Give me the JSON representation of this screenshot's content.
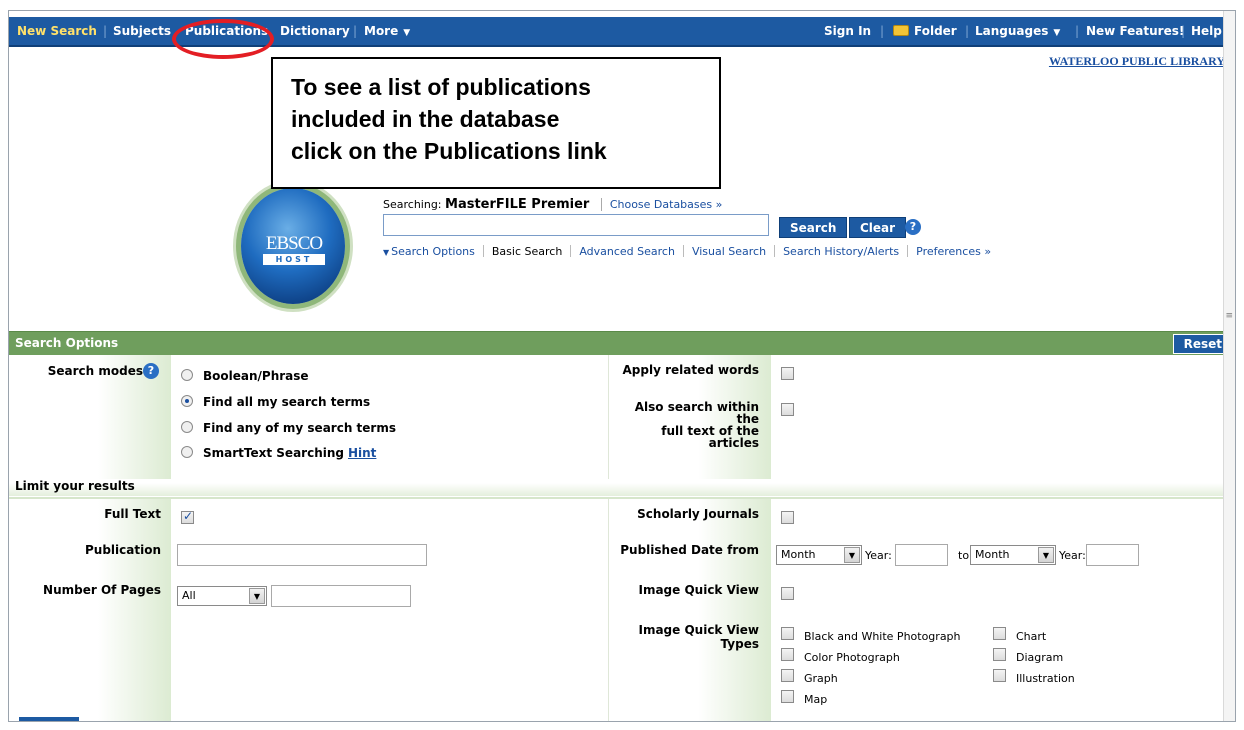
{
  "topnav": {
    "new_search": "New Search",
    "subjects": "Subjects",
    "publications": "Publications",
    "dictionary": "Dictionary",
    "more": "More",
    "sign_in": "Sign In",
    "folder": "Folder",
    "languages": "Languages",
    "new_features": "New Features!",
    "help": "Help"
  },
  "library_name": "WATERLOO PUBLIC LIBRARY",
  "callout": {
    "line1": "To see a list of publications",
    "line2": "included in the database",
    "line3": "click on the Publications link"
  },
  "logo": {
    "text": "EBSCO",
    "subtext": "HOST"
  },
  "search": {
    "searching_label": "Searching:",
    "database": "MasterFILE Premier",
    "choose_databases": "Choose Databases »",
    "query": "",
    "search_button": "Search",
    "clear_button": "Clear",
    "help": "?"
  },
  "subnav": {
    "search_options": "Search Options",
    "basic_search": "Basic Search",
    "advanced_search": "Advanced Search",
    "visual_search": "Visual Search",
    "search_history": "Search History/Alerts",
    "preferences": "Preferences »"
  },
  "search_options": {
    "title": "Search Options",
    "reset": "Reset",
    "search_modes_label": "Search modes",
    "modes": [
      "Boolean/Phrase",
      "Find all my search terms",
      "Find any of my search terms",
      "SmartText Searching"
    ],
    "selected_mode": "Find all my search terms",
    "hint": "Hint",
    "apply_related_words": "Apply related words",
    "also_search_full_text_line1": "Also search within the",
    "also_search_full_text_line2": "full text of the articles"
  },
  "limits": {
    "title": "Limit your results",
    "full_text": "Full Text",
    "publication": "Publication",
    "number_of_pages": "Number Of Pages",
    "pages_value": "All",
    "scholarly_journals": "Scholarly Journals",
    "published_date_from": "Published Date from",
    "month1": "Month",
    "year_label": "Year:",
    "to_label": "to",
    "month2": "Month",
    "image_quick_view": "Image Quick View",
    "image_quick_view_types": "Image Quick View Types",
    "types": [
      "Black and White Photograph",
      "Chart",
      "Color Photograph",
      "Diagram",
      "Graph",
      "Illustration",
      "Map"
    ]
  },
  "colors": {
    "nav_blue": "#1d5aa2",
    "options_green": "#6f9e5d",
    "highlight_red": "#e31e24",
    "link_blue": "#1a4fa0"
  }
}
